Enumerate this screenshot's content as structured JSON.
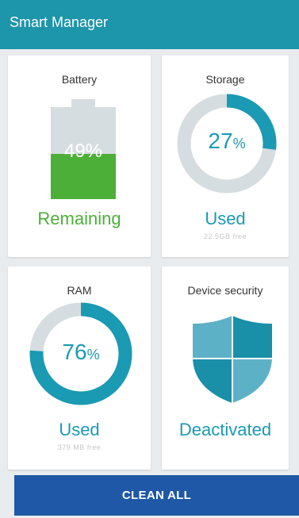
{
  "app_title": "Smart Manager",
  "colors": {
    "accent": "#1d95ab",
    "battery_green": "#4caf37",
    "button_blue": "#1e58a6",
    "track_gray": "#d6dde0"
  },
  "battery": {
    "label": "Battery",
    "percent_text": "49%",
    "level": 0.49,
    "status": "Remaining"
  },
  "storage": {
    "label": "Storage",
    "percent_num": "27",
    "percent_unit": "%",
    "used_fraction": 0.27,
    "status": "Used",
    "sub_text": "22.5GB free"
  },
  "ram": {
    "label": "RAM",
    "percent_num": "76",
    "percent_unit": "%",
    "used_fraction": 0.76,
    "status": "Used",
    "sub_text": "379 MB free"
  },
  "security": {
    "label": "Device security",
    "status": "Deactivated",
    "icon": "shield-icon"
  },
  "clean_button": {
    "label": "CLEAN ALL"
  }
}
